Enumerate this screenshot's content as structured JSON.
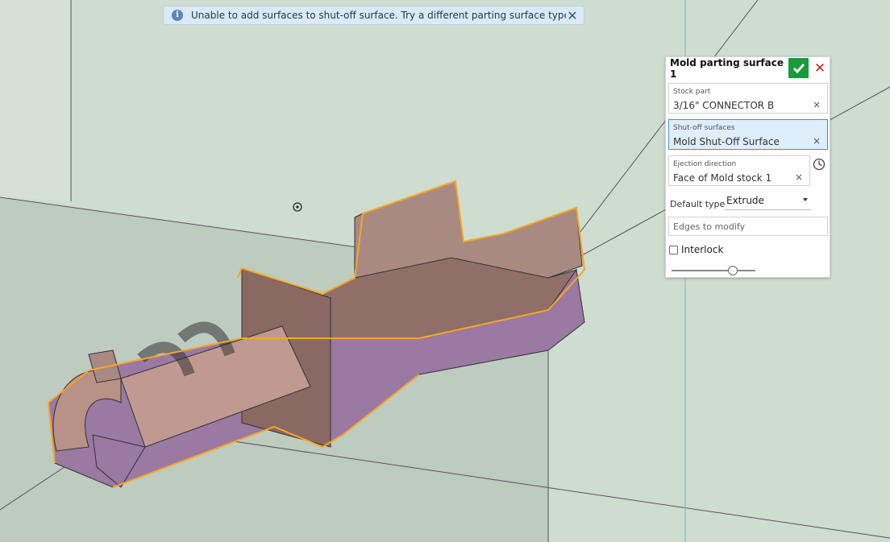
{
  "notification": {
    "message": "Unable to add surfaces to shut-off surface. Try a different parting surface type.",
    "info_icon": "i",
    "close_glyph": "✕"
  },
  "panel": {
    "title": "Mold parting surface 1",
    "cancel_glyph": "✕",
    "stock_part": {
      "label": "Stock part",
      "value": "3/16\" CONNECTOR B"
    },
    "shutoff": {
      "label": "Shut-off surfaces",
      "value": "Mold Shut-Off Surface"
    },
    "ejection": {
      "label": "Ejection direction",
      "value": "Face of Mold stock 1"
    },
    "clear_glyph": "×",
    "default_type": {
      "label": "Default type",
      "value": "Extrude"
    },
    "edges_placeholder": "Edges to modify",
    "interlock_label": "Interlock",
    "interlock_checked": false,
    "slider_level": 0.72
  },
  "colors": {
    "accent_ok": "#169c3c",
    "cancel": "#c8202c",
    "active_field": "#deeefb",
    "part_top": "#a98a82",
    "part_bottom": "#9a79a3",
    "highlight": "#f5a623"
  }
}
